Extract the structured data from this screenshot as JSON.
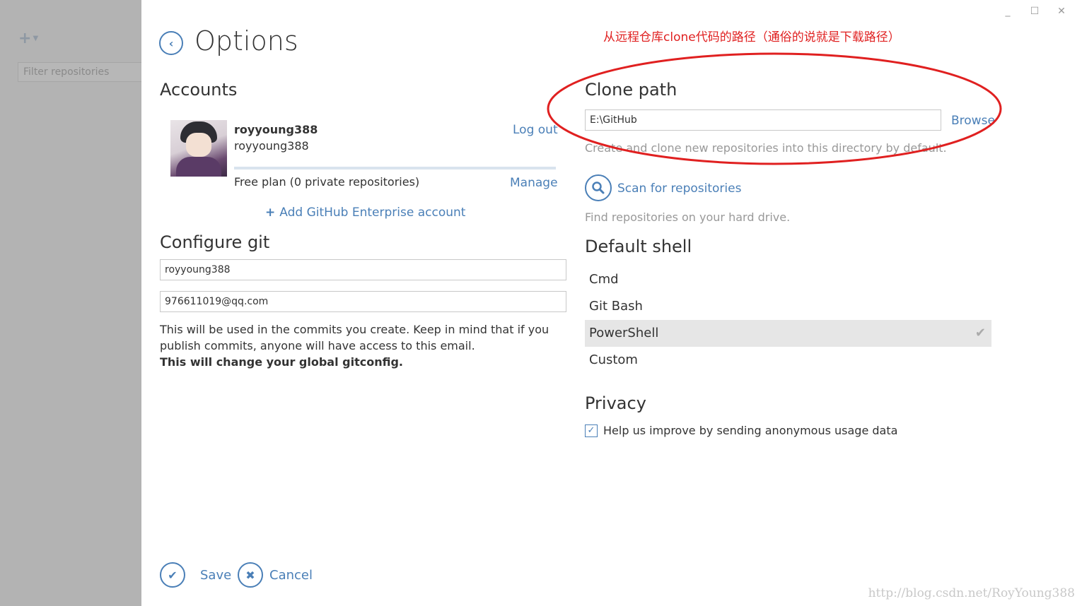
{
  "sidebar": {
    "add_icon": "plus-icon",
    "filter_placeholder": "Filter repositories"
  },
  "window": {
    "minimize": "_",
    "maximize": "☐",
    "close": "✕"
  },
  "header": {
    "title": "Options",
    "back_icon": "chevron-left-icon"
  },
  "accounts": {
    "heading": "Accounts",
    "name": "royyoung388",
    "login": "royyoung388",
    "logout_label": "Log out",
    "plan": "Free plan (0 private repositories)",
    "manage_label": "Manage",
    "add_enterprise_plus": "+",
    "add_enterprise_label": "Add GitHub Enterprise account"
  },
  "configure_git": {
    "heading": "Configure git",
    "username": "royyoung388",
    "email": "976611019@qq.com",
    "help_line": "This will be used in the commits you create. Keep in mind that if you publish commits, anyone will have access to this email.",
    "help_strong": "This will change your global gitconfig."
  },
  "clone_path": {
    "heading": "Clone path",
    "value": "E:\\GitHub",
    "browse_label": "Browse",
    "description": "Create and clone new repositories into this directory by default."
  },
  "scan": {
    "label": "Scan for repositories",
    "description": "Find repositories on your hard drive.",
    "icon": "search-icon"
  },
  "default_shell": {
    "heading": "Default shell",
    "options": [
      "Cmd",
      "Git Bash",
      "PowerShell",
      "Custom"
    ],
    "selected": "PowerShell"
  },
  "privacy": {
    "heading": "Privacy",
    "checkbox_label": "Help us improve by sending anonymous usage data",
    "checked": true
  },
  "footer": {
    "save_label": "Save",
    "cancel_label": "Cancel"
  },
  "annotation": {
    "text": "从远程仓库clone代码的路径（通俗的说就是下载路径）",
    "color": "#e02020"
  },
  "watermark": "http://blog.csdn.net/RoyYoung388",
  "colors": {
    "accent": "#4a7fb7",
    "sidebar": "#b3b3b3",
    "selected_row": "#e6e6e6"
  }
}
